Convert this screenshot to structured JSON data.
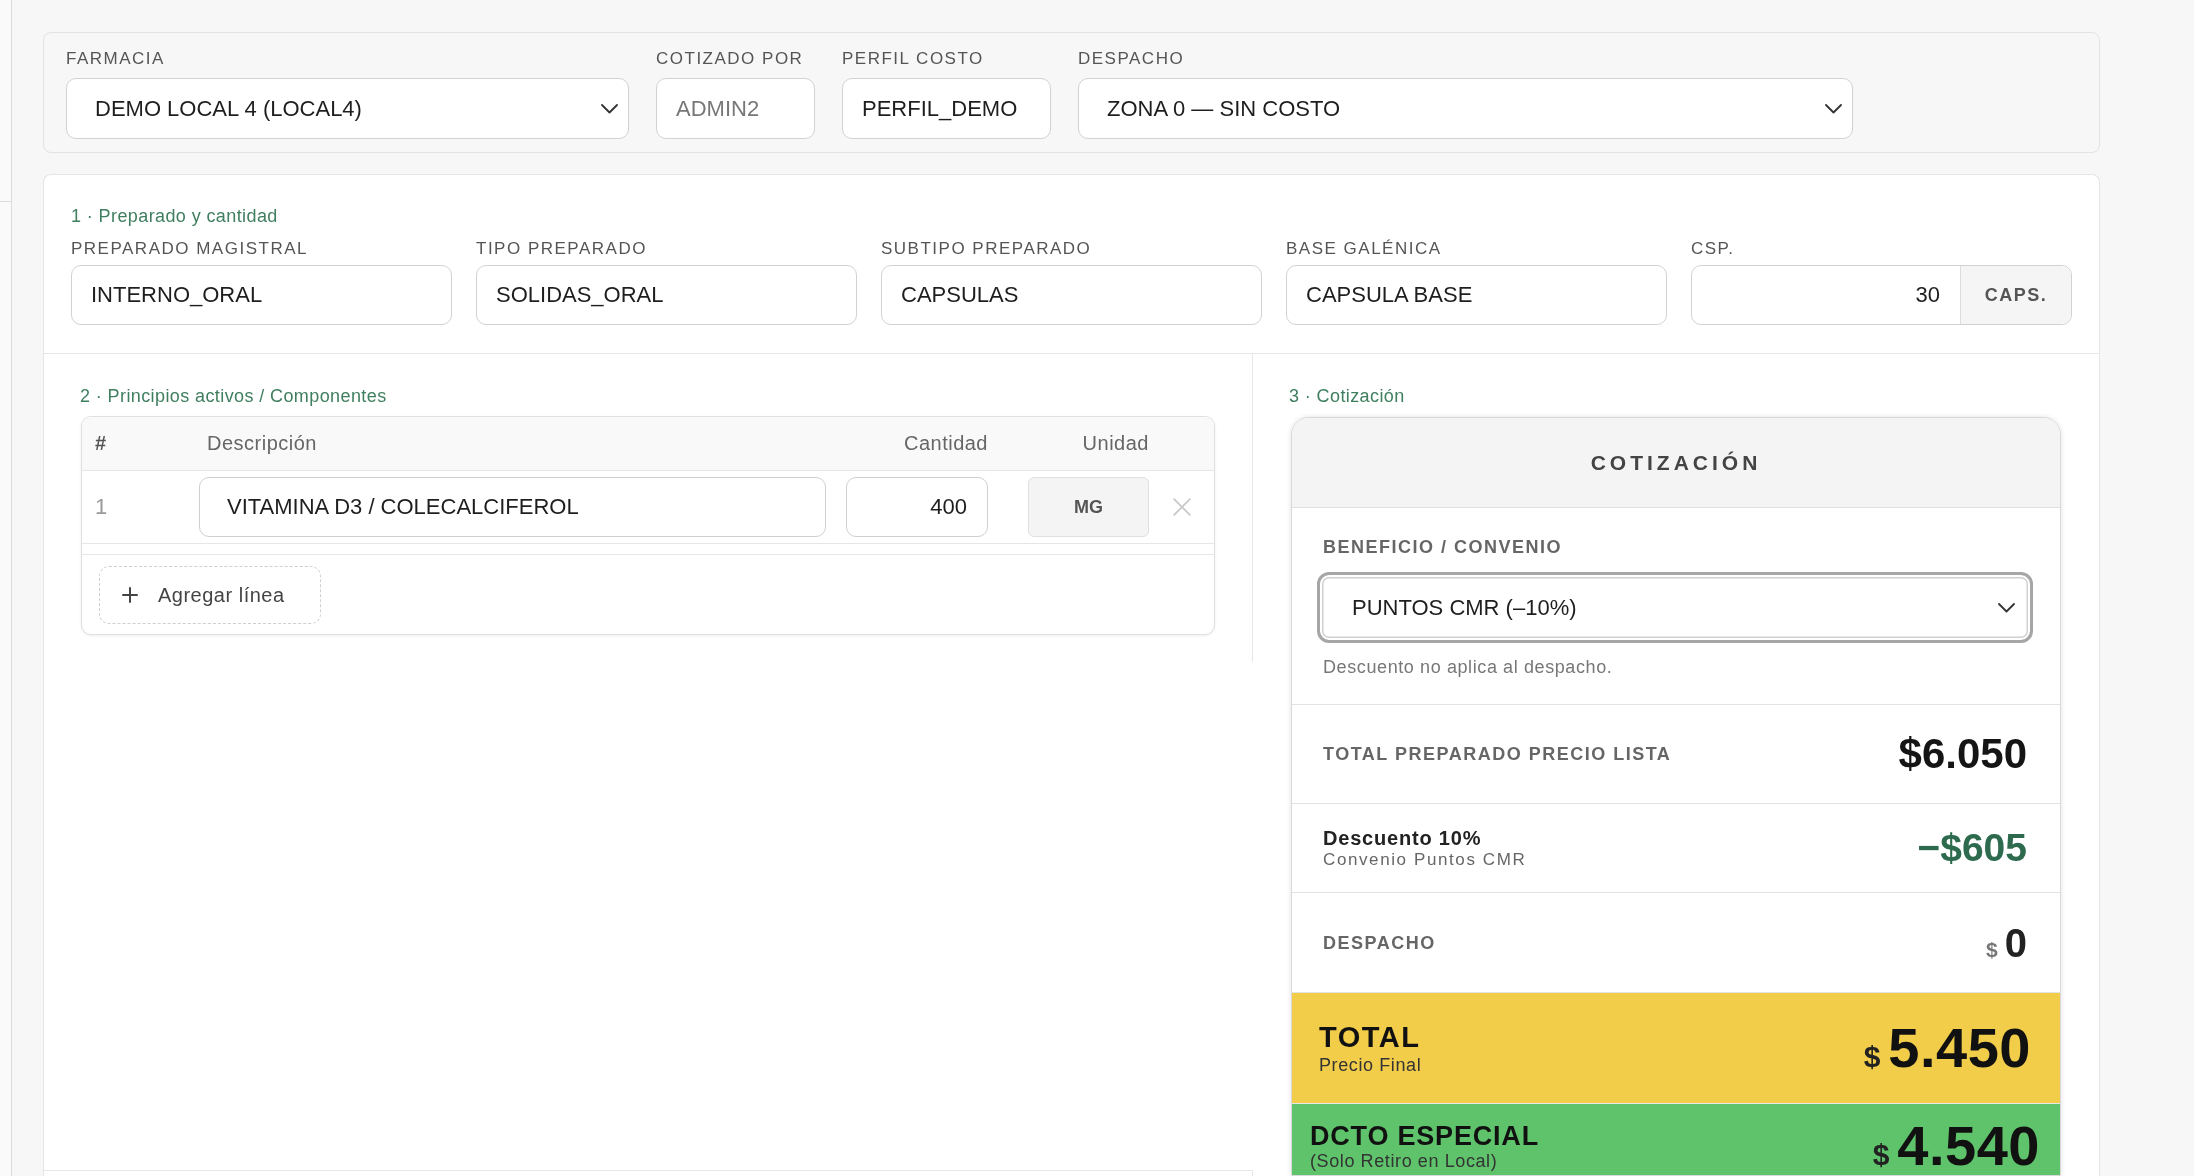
{
  "header": {
    "fields": [
      {
        "kind": "select",
        "label": "FARMACIA",
        "value": "DEMO LOCAL 4 (LOCAL4)"
      },
      {
        "kind": "readonly",
        "label": "COTIZADO POR",
        "value": "ADMIN2"
      },
      {
        "kind": "text",
        "label": "PERFIL COSTO",
        "value": "PERFIL_DEMO"
      },
      {
        "kind": "select",
        "label": "DESPACHO",
        "value": "ZONA 0 — SIN COSTO"
      }
    ]
  },
  "preparation": {
    "title": "1 · Preparado y cantidad",
    "fields": [
      {
        "kind": "text",
        "label": "PREPARADO MAGISTRAL",
        "value": "INTERNO_ORAL"
      },
      {
        "kind": "text",
        "label": "TIPO PREPARADO",
        "value": "SOLIDAS_ORAL"
      },
      {
        "kind": "text",
        "label": "SUBTIPO PREPARADO",
        "value": "CAPSULAS"
      },
      {
        "kind": "text",
        "label": "BASE GALÉNICA",
        "value": "CAPSULA BASE"
      },
      {
        "kind": "quantity",
        "label": "CSP.",
        "value": "30",
        "unit": "CAPS."
      }
    ]
  },
  "components": {
    "title": "2 · Principios activos / Componentes",
    "columns": [
      "#",
      "Descripción",
      "Cantidad",
      "Unidad"
    ],
    "rows": [
      {
        "number": "1",
        "description": "VITAMINA D3 / COLECALCIFEROL",
        "quantity": "400",
        "unit": "MG"
      }
    ],
    "add_button": "Agregar línea"
  },
  "quote": {
    "title": "3 · Cotización",
    "heading": "COTIZACIÓN",
    "benefit": {
      "label": "BENEFICIO / CONVENIO",
      "value": "PUNTOS CMR (–10%)",
      "focused": true,
      "hint": "Descuento no aplica al despacho."
    },
    "lines": [
      {
        "kind": "plain",
        "label": "TOTAL PREPARADO PRECIO LISTA",
        "amount": "$6.050"
      },
      {
        "kind": "discount",
        "label": "Descuento 10%",
        "sublabel": "Convenio Puntos CMR",
        "amount": "−$605"
      },
      {
        "kind": "split",
        "label": "DESPACHO",
        "currency": "$",
        "amount": "0"
      }
    ],
    "totals": [
      {
        "kind": "total",
        "label": "TOTAL",
        "sublabel": "Precio Final",
        "currency": "$",
        "amount": "5.450",
        "color": "#f2cd4a"
      },
      {
        "kind": "special",
        "label": "DCTO ESPECIAL",
        "sublabel": "(Solo Retiro en Local)",
        "currency": "$",
        "amount": "4.540",
        "color": "#5ec36a"
      }
    ]
  }
}
